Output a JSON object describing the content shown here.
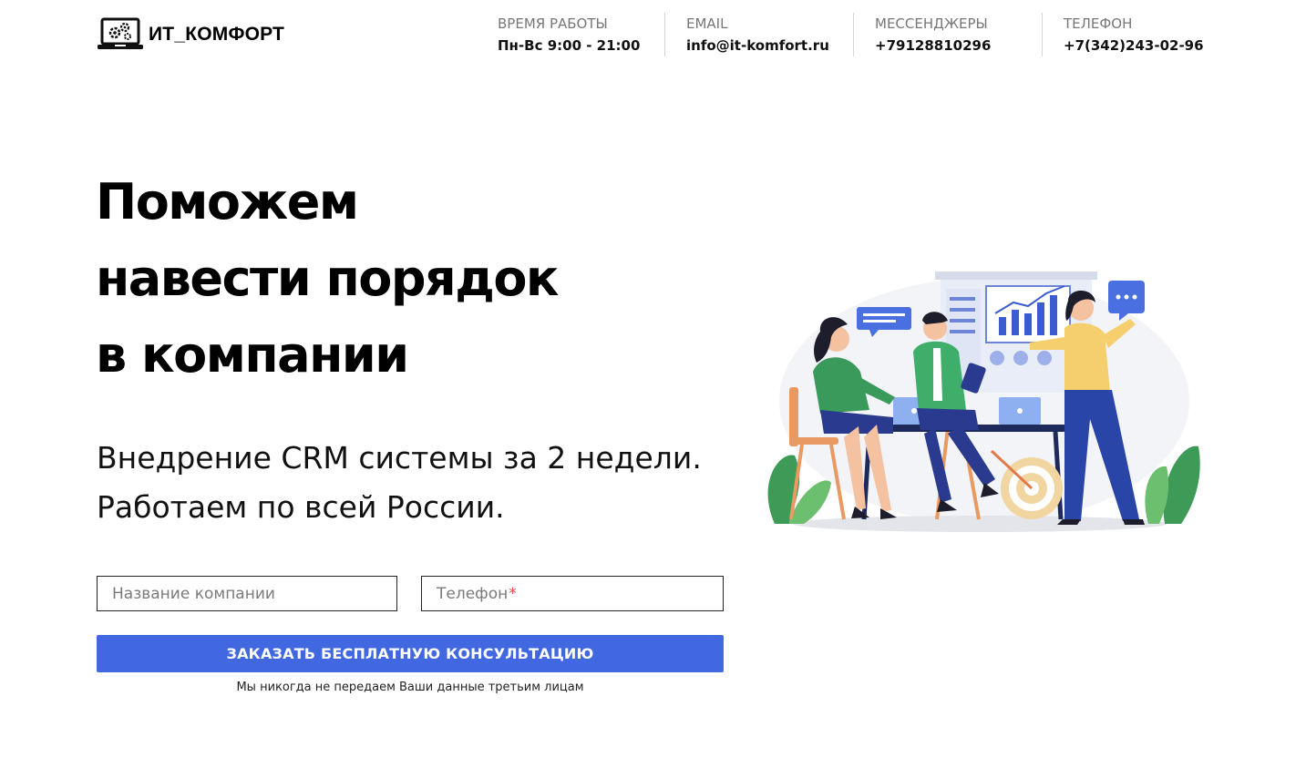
{
  "header": {
    "logo_text": "ИТ_КОМФОРТ",
    "hours_label": "ВРЕМЯ РАБОТЫ",
    "hours_value": "Пн-Вс 9:00 - 21:00",
    "email_label": "EMAIL",
    "email_value": "info@it-komfort.ru",
    "messengers_label": "МЕССЕНДЖЕРЫ",
    "messengers_value": "+79128810296",
    "phone_label": "ТЕЛЕФОН",
    "phone_value": "+7(342)243-02-96"
  },
  "hero": {
    "title_lines": [
      "Поможем",
      "навести порядок",
      "в компании"
    ],
    "subtitle_lines": [
      "Внедрение CRM системы за 2 недели.",
      "Работаем по всей России."
    ]
  },
  "form": {
    "company_placeholder": "Название компании",
    "phone_placeholder": "Телефон",
    "required_mark": "*",
    "submit_label": "ЗАКАЗАТЬ БЕСПЛАТНУЮ КОНСУЛЬТАЦИЮ",
    "privacy_note": "Мы никогда не передаем Ваши данные третьим лицам"
  },
  "colors": {
    "accent": "#4168e0",
    "required": "#e04a3f",
    "label_gray": "#777777"
  },
  "icons": {
    "logo": "laptop-gears-icon"
  }
}
